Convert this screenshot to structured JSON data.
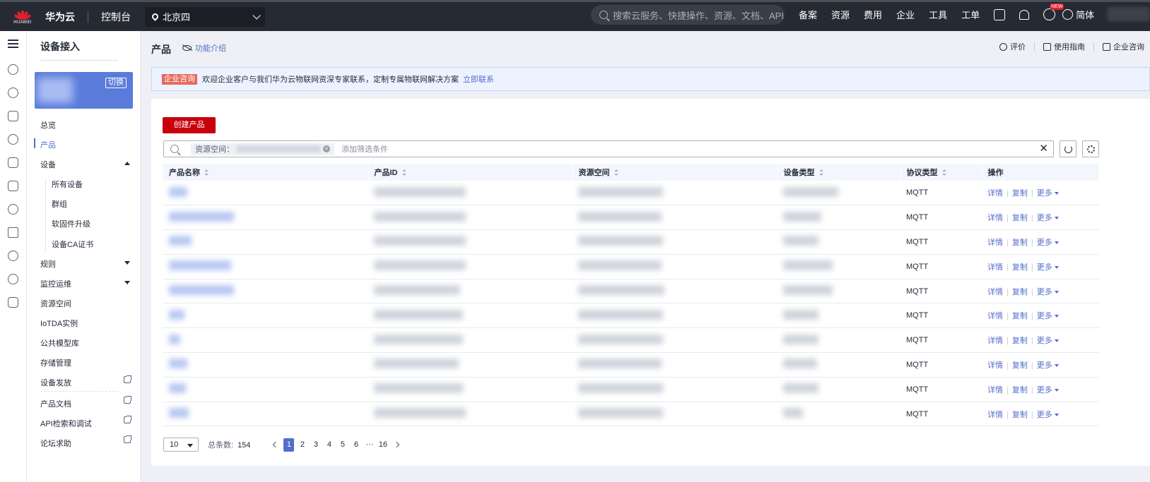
{
  "topbar": {
    "brand": "HUAWEI",
    "title": "华为云",
    "console": "控制台",
    "region": "北京四",
    "search_placeholder": "搜索云服务、快捷操作、资源、文档、API",
    "nav": [
      "备案",
      "资源",
      "费用",
      "企业",
      "工具",
      "工单"
    ],
    "new_badge": "NEW",
    "lang": "简体"
  },
  "side": {
    "title": "设备接入",
    "switch_label": "切换",
    "items": {
      "overview": "总览",
      "product": "产品",
      "device": "设备",
      "all_devices": "所有设备",
      "group": "群组",
      "firmware": "软固件升级",
      "device_ca": "设备CA证书",
      "rules": "规则",
      "monitor": "监控运维",
      "resource_space": "资源空间",
      "iotda": "IoTDA实例",
      "model_lib": "公共模型库",
      "storage": "存储管理",
      "provisioning": "设备发放",
      "product_doc": "产品文档",
      "api": "API检索和调试",
      "forum": "论坛求助"
    }
  },
  "main": {
    "page_title": "产品",
    "func_intro": "功能介绍",
    "links": {
      "rate": "评价",
      "guide": "使用指南",
      "consult": "企业咨询"
    },
    "banner": {
      "tag": "企业咨询",
      "text": "欢迎企业客户与我们华为云物联网资深专家联系，定制专属物联网解决方案",
      "link": "立即联系"
    },
    "create_button": "创建产品",
    "filter": {
      "chip_label": "资源空间：",
      "placeholder": "添加筛选条件"
    },
    "table": {
      "headers": [
        "产品名称",
        "产品ID",
        "资源空间",
        "设备类型",
        "协议类型",
        "操作"
      ],
      "protocol": "MQTT",
      "ops": {
        "detail": "详情",
        "copy": "复制",
        "more": "更多"
      },
      "row_count": 10
    },
    "pager": {
      "page_size": "10",
      "total_label": "总条数:",
      "total": "154",
      "pages": [
        "1",
        "2",
        "3",
        "4",
        "5",
        "6",
        "···",
        "16"
      ],
      "current": "1"
    }
  },
  "colors": {
    "accent": "#526ecc",
    "brand_red": "#c7000b",
    "topbar": "#262b33"
  }
}
